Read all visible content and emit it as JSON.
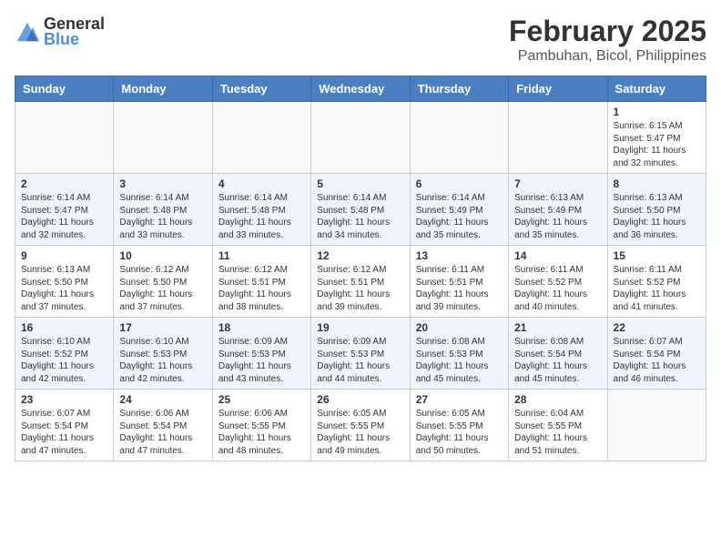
{
  "logo": {
    "general": "General",
    "blue": "Blue"
  },
  "title": {
    "month_year": "February 2025",
    "location": "Pambuhan, Bicol, Philippines"
  },
  "days_of_week": [
    "Sunday",
    "Monday",
    "Tuesday",
    "Wednesday",
    "Thursday",
    "Friday",
    "Saturday"
  ],
  "weeks": [
    [
      {
        "day": "",
        "content": ""
      },
      {
        "day": "",
        "content": ""
      },
      {
        "day": "",
        "content": ""
      },
      {
        "day": "",
        "content": ""
      },
      {
        "day": "",
        "content": ""
      },
      {
        "day": "",
        "content": ""
      },
      {
        "day": "1",
        "content": "Sunrise: 6:15 AM\nSunset: 5:47 PM\nDaylight: 11 hours and 32 minutes."
      }
    ],
    [
      {
        "day": "2",
        "content": "Sunrise: 6:14 AM\nSunset: 5:47 PM\nDaylight: 11 hours and 32 minutes."
      },
      {
        "day": "3",
        "content": "Sunrise: 6:14 AM\nSunset: 5:48 PM\nDaylight: 11 hours and 33 minutes."
      },
      {
        "day": "4",
        "content": "Sunrise: 6:14 AM\nSunset: 5:48 PM\nDaylight: 11 hours and 33 minutes."
      },
      {
        "day": "5",
        "content": "Sunrise: 6:14 AM\nSunset: 5:48 PM\nDaylight: 11 hours and 34 minutes."
      },
      {
        "day": "6",
        "content": "Sunrise: 6:14 AM\nSunset: 5:49 PM\nDaylight: 11 hours and 35 minutes."
      },
      {
        "day": "7",
        "content": "Sunrise: 6:13 AM\nSunset: 5:49 PM\nDaylight: 11 hours and 35 minutes."
      },
      {
        "day": "8",
        "content": "Sunrise: 6:13 AM\nSunset: 5:50 PM\nDaylight: 11 hours and 36 minutes."
      }
    ],
    [
      {
        "day": "9",
        "content": "Sunrise: 6:13 AM\nSunset: 5:50 PM\nDaylight: 11 hours and 37 minutes."
      },
      {
        "day": "10",
        "content": "Sunrise: 6:12 AM\nSunset: 5:50 PM\nDaylight: 11 hours and 37 minutes."
      },
      {
        "day": "11",
        "content": "Sunrise: 6:12 AM\nSunset: 5:51 PM\nDaylight: 11 hours and 38 minutes."
      },
      {
        "day": "12",
        "content": "Sunrise: 6:12 AM\nSunset: 5:51 PM\nDaylight: 11 hours and 39 minutes."
      },
      {
        "day": "13",
        "content": "Sunrise: 6:11 AM\nSunset: 5:51 PM\nDaylight: 11 hours and 39 minutes."
      },
      {
        "day": "14",
        "content": "Sunrise: 6:11 AM\nSunset: 5:52 PM\nDaylight: 11 hours and 40 minutes."
      },
      {
        "day": "15",
        "content": "Sunrise: 6:11 AM\nSunset: 5:52 PM\nDaylight: 11 hours and 41 minutes."
      }
    ],
    [
      {
        "day": "16",
        "content": "Sunrise: 6:10 AM\nSunset: 5:52 PM\nDaylight: 11 hours and 42 minutes."
      },
      {
        "day": "17",
        "content": "Sunrise: 6:10 AM\nSunset: 5:53 PM\nDaylight: 11 hours and 42 minutes."
      },
      {
        "day": "18",
        "content": "Sunrise: 6:09 AM\nSunset: 5:53 PM\nDaylight: 11 hours and 43 minutes."
      },
      {
        "day": "19",
        "content": "Sunrise: 6:09 AM\nSunset: 5:53 PM\nDaylight: 11 hours and 44 minutes."
      },
      {
        "day": "20",
        "content": "Sunrise: 6:08 AM\nSunset: 5:53 PM\nDaylight: 11 hours and 45 minutes."
      },
      {
        "day": "21",
        "content": "Sunrise: 6:08 AM\nSunset: 5:54 PM\nDaylight: 11 hours and 45 minutes."
      },
      {
        "day": "22",
        "content": "Sunrise: 6:07 AM\nSunset: 5:54 PM\nDaylight: 11 hours and 46 minutes."
      }
    ],
    [
      {
        "day": "23",
        "content": "Sunrise: 6:07 AM\nSunset: 5:54 PM\nDaylight: 11 hours and 47 minutes."
      },
      {
        "day": "24",
        "content": "Sunrise: 6:06 AM\nSunset: 5:54 PM\nDaylight: 11 hours and 47 minutes."
      },
      {
        "day": "25",
        "content": "Sunrise: 6:06 AM\nSunset: 5:55 PM\nDaylight: 11 hours and 48 minutes."
      },
      {
        "day": "26",
        "content": "Sunrise: 6:05 AM\nSunset: 5:55 PM\nDaylight: 11 hours and 49 minutes."
      },
      {
        "day": "27",
        "content": "Sunrise: 6:05 AM\nSunset: 5:55 PM\nDaylight: 11 hours and 50 minutes."
      },
      {
        "day": "28",
        "content": "Sunrise: 6:04 AM\nSunset: 5:55 PM\nDaylight: 11 hours and 51 minutes."
      },
      {
        "day": "",
        "content": ""
      }
    ]
  ]
}
